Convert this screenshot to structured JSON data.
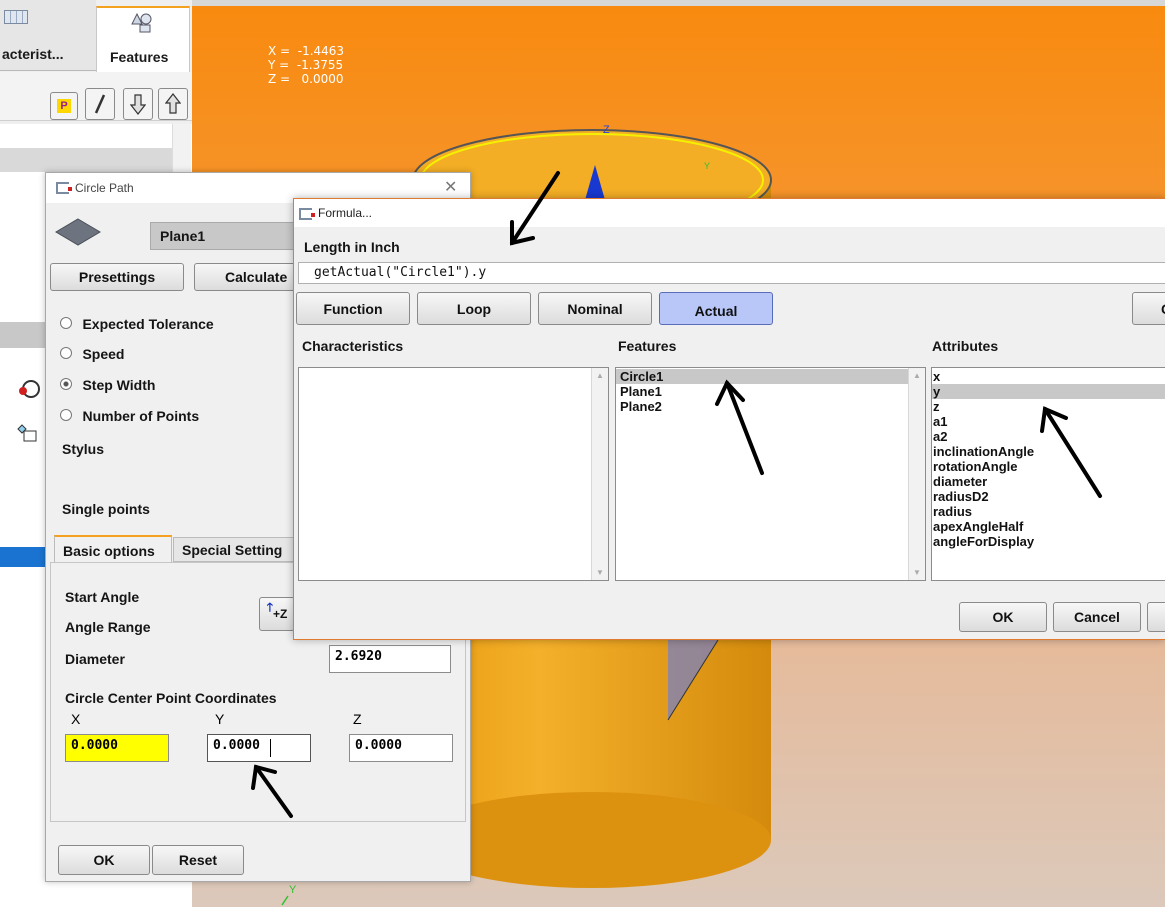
{
  "left_panel": {
    "tabs": [
      {
        "label": "acterist...",
        "icon": "grid-icon"
      },
      {
        "label": "Features",
        "icon": "shapes-icon"
      }
    ],
    "toolbar_icons": [
      "p-badge-icon",
      "pencil-icon",
      "arrow-down-icon",
      "arrow-up-icon"
    ],
    "toolbar_p_label": "P"
  },
  "viewport": {
    "coords": {
      "x_label": "X =",
      "x_value": "-1.4463",
      "y_label": "Y =",
      "y_value": "-1.3755",
      "z_label": "Z =",
      "z_value": "0.0000"
    },
    "axis_z": "Z",
    "axis_y_top": "Y",
    "axis_y_bottom": "Y",
    "colors": {
      "background_top": "#f88a0e",
      "cylinder": "#f2a81c",
      "ring": "#f0f000"
    }
  },
  "circle_path": {
    "title": "Circle Path",
    "plane_value": "Plane1",
    "buttons": {
      "presettings": "Presettings",
      "calculate": "Calculate",
      "ok": "OK",
      "reset": "Reset"
    },
    "radio_options": [
      {
        "label": "Expected Tolerance",
        "selected": false
      },
      {
        "label": "Speed",
        "selected": false
      },
      {
        "label": "Step Width",
        "selected": true
      },
      {
        "label": "Number of Points",
        "selected": false
      }
    ],
    "stylus_label": "Stylus",
    "single_points_label": "Single points",
    "tabs": [
      "Basic options",
      "Special Setting"
    ],
    "start_angle_label": "Start Angle",
    "angle_range_label": "Angle Range",
    "plus_z_label": "+Z",
    "diameter_label": "Diameter",
    "diameter_value": "2.6920",
    "center_label": "Circle Center Point Coordinates",
    "x_label": "X",
    "y_label": "Y",
    "z_label": "Z",
    "x_value": "0.0000",
    "y_value": "0.0000",
    "z_value": "0.0000",
    "highlight_color": "#ffff00"
  },
  "formula": {
    "title": "Formula...",
    "heading": "Length in Inch",
    "expression": "getActual(\"Circle1\").y",
    "buttons": {
      "function": "Function",
      "loop": "Loop",
      "nominal": "Nominal",
      "actual": "Actual",
      "cut": "C",
      "ok": "OK",
      "cancel": "Cancel"
    },
    "characteristics_header": "Characteristics",
    "features_header": "Features",
    "attributes_header": "Attributes",
    "features": [
      "Circle1",
      "Plane1",
      "Plane2"
    ],
    "attributes": [
      "x",
      "y",
      "z",
      "a1",
      "a2",
      "inclinationAngle",
      "rotationAngle",
      "diameter",
      "radiusD2",
      "radius",
      "apexAngleHalf",
      "angleForDisplay"
    ],
    "selected_feature": "Circle1",
    "selected_attribute": "y",
    "active_button_color": "#b8c6f8"
  }
}
